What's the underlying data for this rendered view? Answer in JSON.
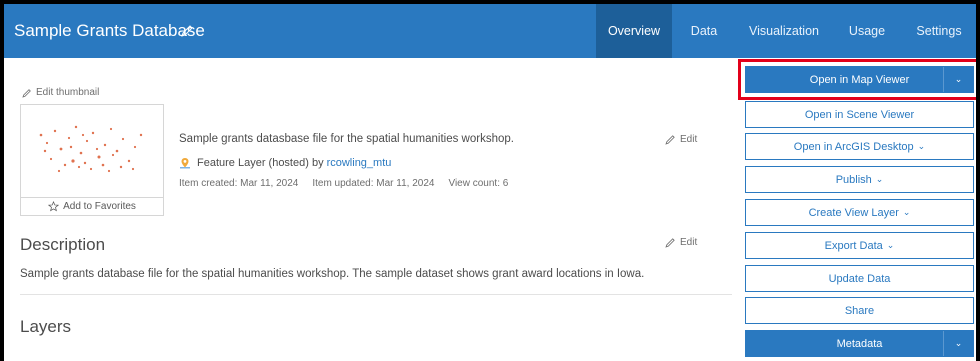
{
  "header": {
    "title": "Sample Grants Database",
    "tabs": [
      {
        "label": "Overview",
        "active": true
      },
      {
        "label": "Data",
        "active": false
      },
      {
        "label": "Visualization",
        "active": false
      },
      {
        "label": "Usage",
        "active": false
      },
      {
        "label": "Settings",
        "active": false
      }
    ]
  },
  "thumbnail": {
    "edit_label": "Edit thumbnail",
    "favorites_label": "Add to Favorites"
  },
  "item": {
    "summary": "Sample grants datasbase file for the spatial humanities workshop.",
    "type_text": "Feature Layer (hosted) by",
    "owner": "rcowling_mtu",
    "created": "Item created: Mar 11, 2024",
    "updated": "Item updated: Mar 11, 2024",
    "views": "View count: 6",
    "edit_label": "Edit"
  },
  "description": {
    "heading": "Description",
    "text": "Sample grants database file for the spatial humanities workshop. The sample dataset shows grant award locations in Iowa.",
    "edit_label": "Edit"
  },
  "layers": {
    "heading": "Layers"
  },
  "actions": {
    "open_map_viewer": "Open in Map Viewer",
    "open_scene_viewer": "Open in Scene Viewer",
    "open_arcgis_desktop": "Open in ArcGIS Desktop",
    "publish": "Publish",
    "create_view_layer": "Create View Layer",
    "export_data": "Export Data",
    "update_data": "Update Data",
    "share": "Share",
    "metadata": "Metadata"
  },
  "colors": {
    "brand_blue": "#2a79c0",
    "active_tab": "#1d5f99",
    "highlight_red": "#e2001a"
  }
}
